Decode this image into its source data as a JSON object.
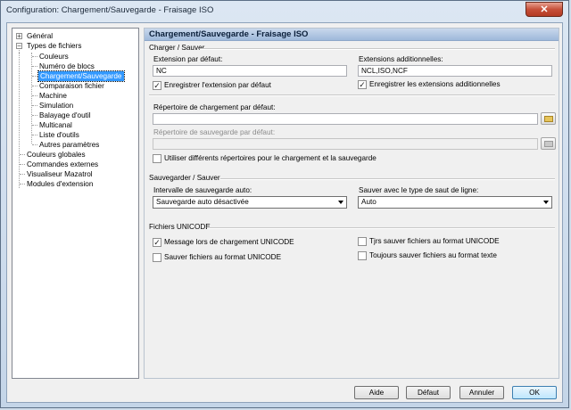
{
  "window": {
    "title": "Configuration: Chargement/Sauvegarde - Fraisage ISO",
    "close_glyph": "✕"
  },
  "tree": {
    "items": [
      {
        "label": "Général",
        "expander": "+"
      },
      {
        "label": "Types de fichiers",
        "expander": "−"
      },
      {
        "label": "Couleurs"
      },
      {
        "label": "Numéro de blocs"
      },
      {
        "label": "Chargement/Sauvegarde",
        "selected": true
      },
      {
        "label": "Comparaison fichier"
      },
      {
        "label": "Machine"
      },
      {
        "label": "Simulation"
      },
      {
        "label": "Balayage d'outil"
      },
      {
        "label": "Multicanal"
      },
      {
        "label": "Liste d'outils"
      },
      {
        "label": "Autres paramètres"
      },
      {
        "label": "Couleurs globales"
      },
      {
        "label": "Commandes externes"
      },
      {
        "label": "Visualiseur Mazatrol"
      },
      {
        "label": "Modules d'extension"
      }
    ]
  },
  "panel": {
    "header": "Chargement/Sauvegarde - Fraisage ISO",
    "load_save": {
      "title": "Charger / Sauver",
      "default_ext_label": "Extension par défaut:",
      "default_ext_value": "NC",
      "save_default_ext_label": "Enregistrer l'extension par défaut",
      "save_default_ext_checked": true,
      "extra_ext_label": "Extensions additionnelles:",
      "extra_ext_value": "NCL,ISO,NCF",
      "save_extra_ext_label": "Enregistrer les extensions additionnelles",
      "save_extra_ext_checked": true,
      "load_dir_label": "Répertoire de chargement par défaut:",
      "load_dir_value": "",
      "save_dir_label": "Répertoire de sauvegarde par défaut:",
      "save_dir_value": "",
      "different_dirs_label": "Utiliser différents répertoires pour le chargement et la sauvegarde",
      "different_dirs_checked": false
    },
    "autosave": {
      "title": "Sauvegarder / Sauver",
      "interval_label": "Intervalle de sauvegarde auto:",
      "interval_value": "Sauvegarde auto désactivée",
      "linebreak_label": "Sauver avec le type de saut de ligne:",
      "linebreak_value": "Auto"
    },
    "unicode": {
      "title": "Fichiers UNICODE",
      "message_label": "Message lors de chargement UNICODE",
      "message_checked": true,
      "save_unicode_label": "Sauver fichiers au format UNICODE",
      "save_unicode_checked": false,
      "always_unicode_label": "Tjrs sauver fichiers au format UNICODE",
      "always_unicode_checked": false,
      "always_text_label": "Toujours sauver fichiers au format texte",
      "always_text_checked": false
    }
  },
  "buttons": {
    "help": "Aide",
    "default": "Défaut",
    "cancel": "Annuler",
    "ok": "OK"
  },
  "check_glyph": "✓"
}
